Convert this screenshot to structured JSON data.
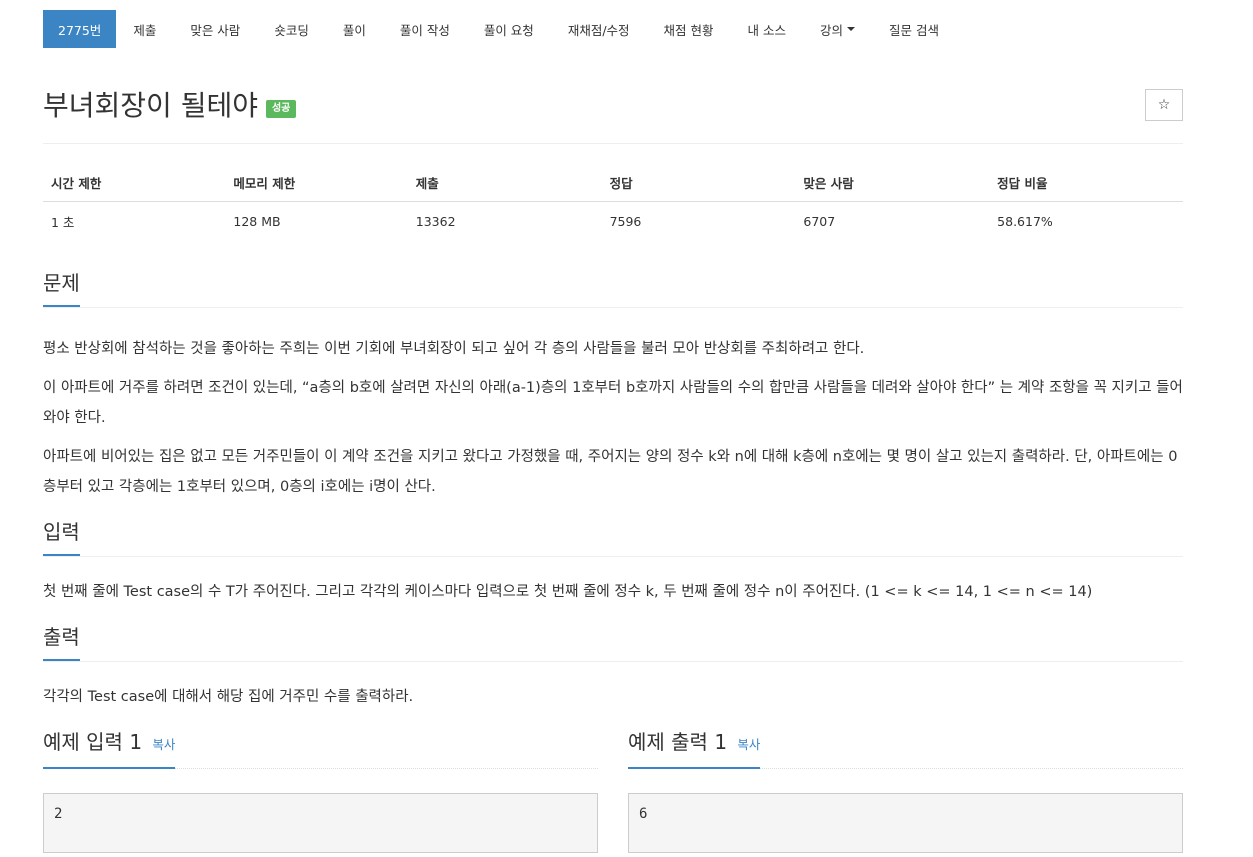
{
  "nav": {
    "items": [
      {
        "label": "2775번",
        "active": true
      },
      {
        "label": "제출"
      },
      {
        "label": "맞은 사람"
      },
      {
        "label": "숏코딩"
      },
      {
        "label": "풀이"
      },
      {
        "label": "풀이 작성"
      },
      {
        "label": "풀이 요청"
      },
      {
        "label": "재채점/수정"
      },
      {
        "label": "채점 현황"
      },
      {
        "label": "내 소스"
      },
      {
        "label": "강의",
        "dropdown": true
      },
      {
        "label": "질문 검색"
      }
    ]
  },
  "problem": {
    "title": "부녀회장이 될테야",
    "badge": "성공",
    "star": "☆"
  },
  "stats": {
    "headers": [
      "시간 제한",
      "메모리 제한",
      "제출",
      "정답",
      "맞은 사람",
      "정답 비율"
    ],
    "values": [
      "1 초",
      "128 MB",
      "13362",
      "7596",
      "6707",
      "58.617%"
    ]
  },
  "sections": {
    "problem": {
      "title": "문제",
      "paragraphs": [
        "평소 반상회에 참석하는 것을 좋아하는 주희는 이번 기회에 부녀회장이 되고 싶어 각 층의 사람들을 불러 모아 반상회를 주최하려고 한다.",
        "이 아파트에 거주를 하려면 조건이 있는데, “a층의 b호에 살려면 자신의 아래(a-1)층의 1호부터 b호까지 사람들의 수의 합만큼 사람들을 데려와 살아야 한다” 는 계약 조항을 꼭 지키고 들어와야 한다.",
        "아파트에 비어있는 집은 없고 모든 거주민들이 이 계약 조건을 지키고 왔다고 가정했을 때, 주어지는 양의 정수 k와 n에 대해 k층에 n호에는 몇 명이 살고 있는지 출력하라. 단, 아파트에는 0층부터 있고 각층에는 1호부터 있으며, 0층의 i호에는 i명이 산다."
      ]
    },
    "input": {
      "title": "입력",
      "text": "첫 번째 줄에 Test case의 수 T가 주어진다. 그리고 각각의 케이스마다 입력으로 첫 번째 줄에 정수 k, 두 번째 줄에 정수 n이 주어진다. (1 <= k <= 14, 1 <= n <= 14)"
    },
    "output": {
      "title": "출력",
      "text": "각각의 Test case에 대해서 해당 집에 거주민 수를 출력하라."
    }
  },
  "samples": {
    "input": {
      "title": "예제 입력 1",
      "copy": "복사",
      "content": "2"
    },
    "output": {
      "title": "예제 출력 1",
      "copy": "복사",
      "content": "6"
    }
  }
}
